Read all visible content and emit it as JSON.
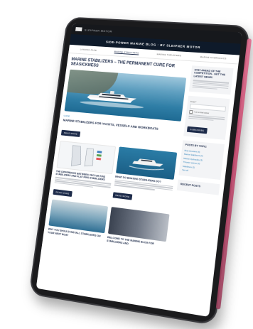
{
  "site": {
    "logo_text": "SLEIPNER MOTOR",
    "blog_banner": "SIDE-POWER MARINE BLOG · BY SLEIPNER MOTOR"
  },
  "nav": {
    "items": [
      {
        "label": "LANDING PAGE"
      },
      {
        "label": "MARINE STABILIZERS"
      },
      {
        "label": "MARINE THRUSTERS"
      },
      {
        "label": "MARINE HYDRAULICS"
      }
    ],
    "active_index": 1
  },
  "hero_post": {
    "title": "MARINE STABILIZERS – THE PERMANENT CURE FOR SEASICKNESS"
  },
  "featured": {
    "category": "GUIDE",
    "title": "MARINE STABILIZERS FOR YACHTS, VESSELS AND WORKBOATS",
    "button": "READ MORE"
  },
  "cards": [
    {
      "title": "THE DIFFERENCE BETWEEN VECTOR FINS STABILIZERS AND FLAT FINS STABILIZERS",
      "button": "READ MORE",
      "image": "fins"
    },
    {
      "title": "WHAT DO BOATING STABILIZERS DO?",
      "button": "READ MORE",
      "image": "boat"
    },
    {
      "title": "WHY YOU SHOULD INSTALL STABILIZERS ON YOUR NEXT BOAT",
      "image": "shore"
    },
    {
      "title": "WELCOME TO THE MARINE BLOG FOR STABILIZERS AND",
      "image": "crew"
    }
  ],
  "sidebar": {
    "newsletter_title": "STAY AHEAD OF THE COMPETITION - GET THE LATEST NEWS!",
    "form": {
      "email_label": "Email *",
      "interest_label": "I am a boat owner",
      "submit_label": "SUBSCRIBE"
    },
    "topics_title": "POSTS BY TOPIC",
    "topics": [
      "Boat thrusters (4)",
      "Marine Stabilizers (4)",
      "Marine Hydraulics (3)",
      "Thruster advice (3)",
      "Stabilizers (2)",
      "See all"
    ],
    "recent_title": "RECENT POSTS"
  },
  "colors": {
    "navy": "#1d2b4a",
    "link": "#2a7fb8",
    "tablet_edge": "#c94a70"
  }
}
